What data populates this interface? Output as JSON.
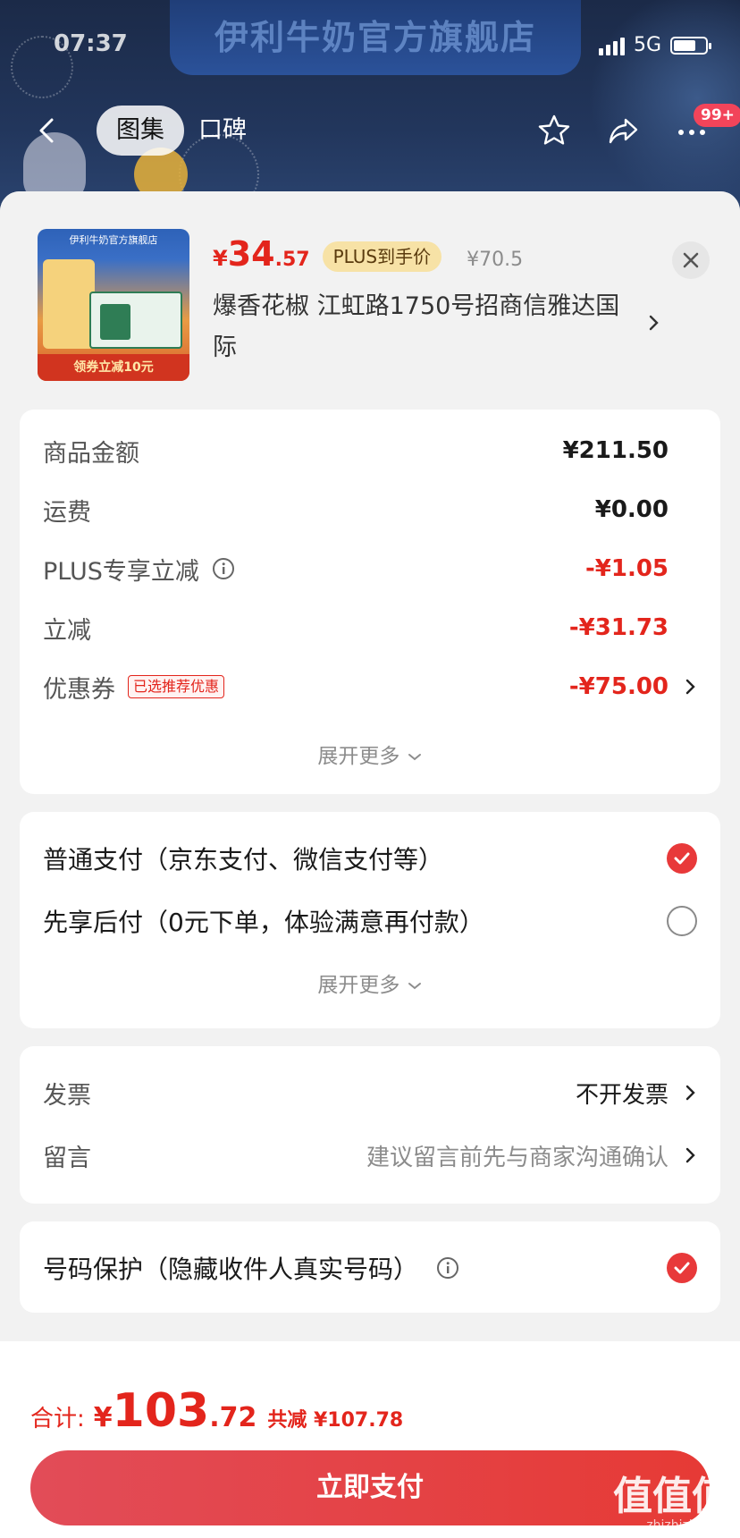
{
  "status_bar": {
    "time": "07:37",
    "network": "5G"
  },
  "banner": {
    "text": "伊利牛奶官方旗舰店"
  },
  "nav": {
    "tab_active": "图集",
    "tab_other": "口碑",
    "badge": "99+"
  },
  "product": {
    "image_store": "伊利牛奶官方旗舰店",
    "image_coupon": "领券立减10元",
    "price_currency": "¥",
    "price_int": "34",
    "price_dec": ".57",
    "plus_label": "PLUS到手价",
    "orig_price": "¥70.5",
    "address": "爆香花椒  江虹路1750号招商信雅达国际"
  },
  "summary": {
    "rows": [
      {
        "label": "商品金额",
        "value": "¥211.50"
      },
      {
        "label": "运费",
        "value": "¥0.00"
      },
      {
        "label": "PLUS专享立减",
        "value": "-¥1.05"
      },
      {
        "label": "立减",
        "value": "-¥31.73"
      },
      {
        "label": "优惠券",
        "tag": "已选推荐优惠",
        "value": "-¥75.00"
      }
    ],
    "more": "展开更多"
  },
  "payment": {
    "options": [
      {
        "label": "普通支付（京东支付、微信支付等）",
        "selected": true
      },
      {
        "label": "先享后付（0元下单，体验满意再付款）",
        "selected": false
      }
    ],
    "more": "展开更多"
  },
  "extras": {
    "invoice_label": "发票",
    "invoice_value": "不开发票",
    "note_label": "留言",
    "note_value": "建议留言前先与商家沟通确认"
  },
  "privacy": {
    "label": "号码保护（隐藏收件人真实号码）",
    "checked": true
  },
  "footer": {
    "total_label": "合计:",
    "total_currency": "¥",
    "total_int": "103",
    "total_dec": ".72",
    "saved": "共减 ¥107.78",
    "pay_button": "立即支付"
  },
  "watermark": {
    "brand": "值值值",
    "site": "zhizhizhi.com"
  },
  "colors": {
    "accent_red": "#e3251c",
    "plus_gold": "#f7e2a6",
    "background": "#f2f2f2"
  }
}
